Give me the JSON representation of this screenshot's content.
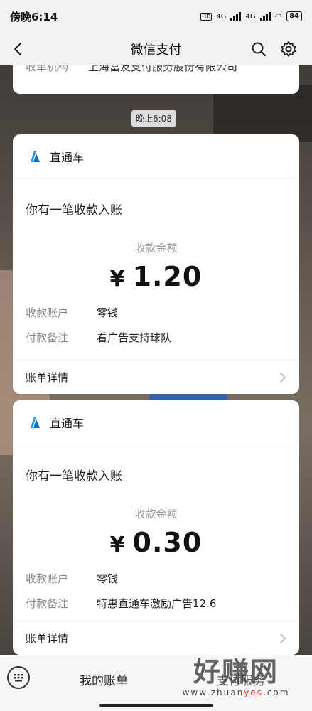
{
  "status": {
    "time": "傍晚6:14",
    "net1": "4G",
    "net2": "4G",
    "battery": "84"
  },
  "nav": {
    "title": "微信支付"
  },
  "top_card": {
    "key": "收单机构",
    "value": "上海富友支付服务股份有限公司"
  },
  "time_chip": "晚上6:08",
  "messages": [
    {
      "sender": "直通车",
      "notice": "你有一笔收款入账",
      "amount_label": "收款金额",
      "currency": "¥",
      "amount": "1.20",
      "account_key": "收款账户",
      "account_value": "零钱",
      "remark_key": "付款备注",
      "remark_value": "看广告支持球队",
      "detail": "账单详情"
    },
    {
      "sender": "直通车",
      "notice": "你有一笔收款入账",
      "amount_label": "收款金额",
      "currency": "¥",
      "amount": "0.30",
      "account_key": "收款账户",
      "account_value": "零钱",
      "remark_key": "付款备注",
      "remark_value": "特惠直通车激励广告12.6",
      "detail": "账单详情"
    }
  ],
  "bottom": {
    "item1": "我的账单",
    "item2": "支付服务"
  },
  "watermark": {
    "big": "好赚网",
    "small_pre": "www.zhuan",
    "small_hl": "yes",
    "small_post": ".com"
  },
  "colors": {
    "accent": "#1aa1e0",
    "watermark_hl": "#e03a2e"
  }
}
